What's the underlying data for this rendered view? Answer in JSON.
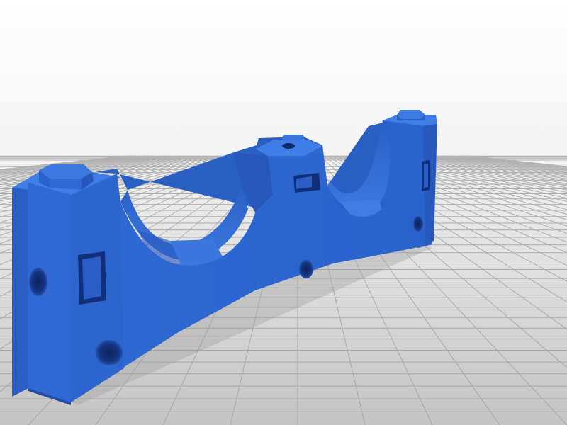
{
  "scene": {
    "subject": "3d-printed-bracket-model",
    "colors": {
      "background_top": "#ffffff",
      "background_bottom": "#c9c9c9",
      "grid_line": "#9c9c9c",
      "part_front": "#2f6bd6",
      "part_front_dark": "#2159be",
      "part_top": "#3f7fe6",
      "part_side": "#2a5fc4",
      "part_inner": "#1c4aa3",
      "part_highlight": "#4a8af0",
      "hole_dark": "#0f2a6b"
    }
  }
}
